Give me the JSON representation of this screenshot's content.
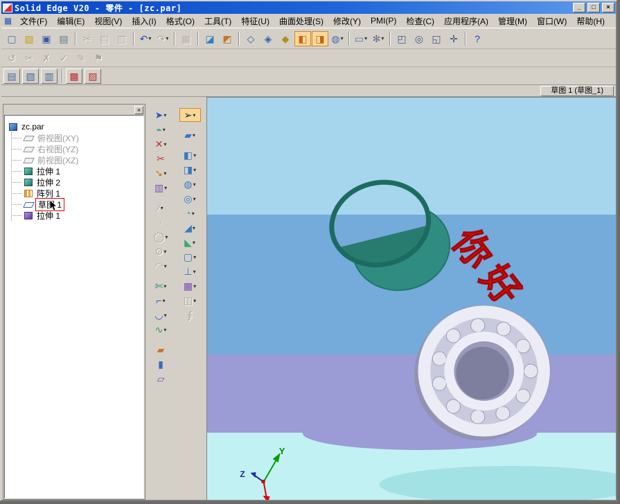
{
  "window": {
    "title": "Solid Edge V20 - 零件 - [zc.par]",
    "minimize": "_",
    "maximize": "□",
    "close": "×"
  },
  "menubar": {
    "doc_icon": "▦",
    "items": [
      "文件(F)",
      "编辑(E)",
      "视图(V)",
      "插入(I)",
      "格式(O)",
      "工具(T)",
      "特征(U)",
      "曲面处理(S)",
      "修改(Y)",
      "PMI(P)",
      "检查(C)",
      "应用程序(A)",
      "管理(M)",
      "窗口(W)",
      "帮助(H)"
    ]
  },
  "toolbar_main": {
    "buttons": [
      {
        "name": "new-document",
        "glyph": "▢",
        "color": "#4a6ea8"
      },
      {
        "name": "open",
        "glyph": "▨",
        "color": "#c8a020"
      },
      {
        "name": "save",
        "glyph": "▣",
        "color": "#3858a8"
      },
      {
        "name": "print",
        "glyph": "▤",
        "color": "#607890"
      },
      {
        "sep": true
      },
      {
        "name": "cut",
        "glyph": "✂",
        "color": "#506880",
        "disabled": true
      },
      {
        "name": "copy",
        "glyph": "▤",
        "color": "#506880",
        "disabled": true
      },
      {
        "name": "paste",
        "glyph": "▥",
        "color": "#506880",
        "disabled": true
      },
      {
        "sep": true
      },
      {
        "name": "undo",
        "glyph": "↶",
        "color": "#2050c0",
        "dropdown": true
      },
      {
        "name": "redo",
        "glyph": "↷",
        "disabled": true,
        "dropdown": true
      },
      {
        "sep": true
      },
      {
        "name": "feature-table",
        "glyph": "▦",
        "disabled": true
      },
      {
        "sep": true
      },
      {
        "name": "sketch-step",
        "glyph": "◪",
        "color": "#3080c0"
      },
      {
        "name": "smart-step",
        "glyph": "◩",
        "color": "#c07828"
      },
      {
        "sep": true
      },
      {
        "name": "view-wireframe",
        "glyph": "◇",
        "color": "#3060b0"
      },
      {
        "name": "view-hidden-edge",
        "glyph": "◈",
        "color": "#3060b0"
      },
      {
        "name": "view-visible-edge",
        "glyph": "◆",
        "color": "#b09020"
      },
      {
        "name": "view-shaded",
        "glyph": "◧",
        "color": "#c06818",
        "pressed": true
      },
      {
        "name": "view-shaded-edges",
        "glyph": "◨",
        "color": "#c06818",
        "pressed": true
      },
      {
        "name": "view-rotate",
        "glyph": "◍",
        "color": "#4070b0",
        "dropdown": true
      },
      {
        "sep": true
      },
      {
        "name": "named-views",
        "glyph": "▭",
        "color": "#5070a0",
        "dropdown": true
      },
      {
        "name": "view-settings",
        "glyph": "✻",
        "color": "#607090",
        "dropdown": true
      },
      {
        "sep": true
      },
      {
        "name": "zoom-area",
        "glyph": "◰",
        "color": "#405880"
      },
      {
        "name": "zoom",
        "glyph": "◎",
        "color": "#405880"
      },
      {
        "name": "fit",
        "glyph": "◱",
        "color": "#405880"
      },
      {
        "name": "pan",
        "glyph": "✛",
        "color": "#405880"
      },
      {
        "sep": true
      },
      {
        "name": "help",
        "glyph": "?",
        "color": "#2040c0"
      }
    ]
  },
  "toolbar_edit": {
    "buttons": [
      {
        "name": "undo-step",
        "glyph": "↺",
        "disabled": true
      },
      {
        "name": "cut-profile",
        "glyph": "✂",
        "disabled": true
      },
      {
        "name": "erase",
        "glyph": "✗",
        "disabled": true
      },
      {
        "name": "check-mark",
        "glyph": "✓",
        "disabled": true
      },
      {
        "name": "pen",
        "glyph": "✎",
        "disabled": true
      },
      {
        "name": "flag",
        "glyph": "⚑",
        "disabled": true
      }
    ]
  },
  "toolbar_view": {
    "buttons": [
      {
        "name": "layout-single",
        "glyph": "▤",
        "color": "#4068a0"
      },
      {
        "name": "layout-split",
        "glyph": "▧",
        "color": "#4068a0"
      },
      {
        "name": "layout-grid",
        "glyph": "▥",
        "color": "#4068a0"
      },
      {
        "sep": true
      },
      {
        "name": "color-manager",
        "glyph": "▩",
        "color": "#c03030"
      },
      {
        "name": "part-painter",
        "glyph": "▨",
        "color": "#c03030"
      }
    ]
  },
  "doc_tab": {
    "label": "草图 1 (草图_1)"
  },
  "edgebar": {
    "close": "×",
    "tree": {
      "root": "zc.par",
      "items": [
        {
          "label": "俯视图(XY)",
          "icon": "sketch-plane",
          "dim": true
        },
        {
          "label": "右视图(YZ)",
          "icon": "sketch-plane",
          "dim": true
        },
        {
          "label": "前视图(XZ)",
          "icon": "sketch-plane",
          "dim": true
        },
        {
          "label": "拉伸 1",
          "icon": "extrude"
        },
        {
          "label": "拉伸 2",
          "icon": "extrude"
        },
        {
          "label": "阵列 1",
          "icon": "pattern"
        },
        {
          "label": "草图 1",
          "icon": "sketch",
          "selected": true
        },
        {
          "label": "拉伸 1",
          "icon": "extrude-purple"
        }
      ]
    }
  },
  "tool_column_primary": {
    "buttons": [
      {
        "name": "select-face",
        "glyph": "➤",
        "color": "#2858c8",
        "dropdown": true
      },
      {
        "name": "connect-relation",
        "glyph": "⌁",
        "color": "#208888",
        "dropdown": true
      },
      {
        "name": "delete-relation",
        "glyph": "✕",
        "color": "#c83030",
        "dropdown": true
      },
      {
        "name": "delete-element",
        "glyph": "✂",
        "color": "#c83030"
      },
      {
        "name": "move-rotate",
        "glyph": "➘",
        "color": "#c87828",
        "dropdown": true
      },
      {
        "name": "pattern-fill",
        "glyph": "▥",
        "color": "#7850b8",
        "dropdown": true
      },
      {
        "gap": true
      },
      {
        "name": "line-tool",
        "glyph": "∕",
        "disabled": true,
        "dropdown": true
      },
      {
        "name": "point-tool",
        "glyph": "·",
        "disabled": true
      },
      {
        "name": "circle-tool",
        "glyph": "◯",
        "disabled": true,
        "dropdown": true
      },
      {
        "name": "ellipse-tool",
        "glyph": "⊙",
        "disabled": true,
        "dropdown": true
      },
      {
        "name": "arc-tool",
        "glyph": "◠",
        "disabled": true,
        "dropdown": true
      },
      {
        "gap": true
      },
      {
        "name": "trim-tool",
        "glyph": "✄",
        "color": "#208888",
        "dropdown": true
      },
      {
        "name": "corner-tool",
        "glyph": "⌐",
        "color": "#2858c8",
        "dropdown": true
      },
      {
        "name": "fillet-tool",
        "glyph": "◡",
        "color": "#2858c8",
        "dropdown": true
      },
      {
        "name": "spline-tool",
        "glyph": "∿",
        "color": "#30a050",
        "dropdown": true
      },
      {
        "gap": true
      },
      {
        "name": "paint-area",
        "glyph": "▰",
        "color": "#c87828"
      },
      {
        "name": "fill-color",
        "glyph": "▮",
        "color": "#3868c0"
      },
      {
        "name": "hatch-pattern",
        "glyph": "▱",
        "color": "#7850b8"
      }
    ]
  },
  "tool_column_feature": {
    "buttons": [
      {
        "name": "select-arrow",
        "glyph": "➢",
        "color": "#202020",
        "pressed": true,
        "dropdown": true
      },
      {
        "gap": true
      },
      {
        "name": "sketch",
        "glyph": "▰",
        "color": "#3878c8",
        "dropdown": true
      },
      {
        "gap": true
      },
      {
        "name": "protrusion",
        "glyph": "◧",
        "color": "#3878c8",
        "dropdown": true
      },
      {
        "name": "cutout",
        "glyph": "◨",
        "color": "#3878c8",
        "dropdown": true
      },
      {
        "name": "revolve",
        "glyph": "◍",
        "color": "#3878c8",
        "dropdown": true
      },
      {
        "name": "hole",
        "glyph": "◎",
        "color": "#3878c8",
        "dropdown": true
      },
      {
        "name": "round",
        "glyph": "◔",
        "color": "#38a8c8",
        "dropdown": true
      },
      {
        "name": "chamfer",
        "glyph": "◢",
        "color": "#3878c8",
        "dropdown": true
      },
      {
        "name": "draft",
        "glyph": "◣",
        "color": "#38a878",
        "dropdown": true
      },
      {
        "name": "thin-wall",
        "glyph": "▢",
        "color": "#3878c8",
        "dropdown": true
      },
      {
        "name": "rib",
        "glyph": "⊥",
        "color": "#3878c8",
        "dropdown": true
      },
      {
        "name": "pattern-feature",
        "glyph": "▦",
        "color": "#7850b8",
        "dropdown": true
      },
      {
        "name": "mirror-copy",
        "glyph": "◫",
        "disabled": true,
        "dropdown": true
      },
      {
        "name": "helix",
        "glyph": "∮",
        "disabled": true
      }
    ]
  },
  "viewport": {
    "sketch_text": "你好",
    "triad": {
      "y": "Y",
      "z": "Z"
    },
    "colors": {
      "band_top": "#a5d6ee",
      "band_mid": "#74abdb",
      "band_lavender": "#9b9bd6",
      "band_bottom": "#c2f1f3",
      "tube": "#2e8d80",
      "tube_edge": "#1d6b60",
      "bearing_face": "#ececf6",
      "bearing_shade": "#9a9ab8",
      "sketch_red": "#dd1c1c",
      "pressed_accent": "#f8d898"
    }
  }
}
